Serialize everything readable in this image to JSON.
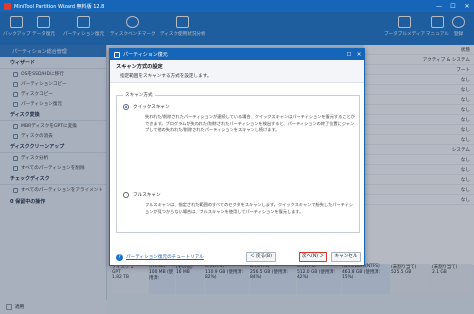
{
  "app": {
    "title": "MiniTool Partition Wizard 無料版 12.8"
  },
  "toolbar": {
    "items": [
      "バックアップ",
      "データ復元",
      "パーティション復元",
      "ディスクベンチマーク",
      "ディスク使用状況分析"
    ],
    "right_items": [
      "ブータブルメディア",
      "マニュアル",
      "登録"
    ]
  },
  "sidebar": {
    "tab": "パーティション総合管理",
    "groups": [
      {
        "title": "ウィザード",
        "items": [
          "OSをSSD/HDに移行",
          "パーティションコピー",
          "ディスクコピー",
          "パーティション復元"
        ]
      },
      {
        "title": "ディスク変換",
        "items": [
          "MBRディスクをGPTに変換",
          "ディスクの消去"
        ]
      },
      {
        "title": "ディスククリーンアップ",
        "items": [
          "ディスク分析",
          "すべてのパーティションを削除"
        ]
      },
      {
        "title": "チェックディスク",
        "items": [
          "すべてのパーティションをアライメント"
        ]
      }
    ],
    "pending": "0 保留中の操作",
    "apply": "適用"
  },
  "right_column": {
    "rows": [
      "状態",
      "アクティブ & システム",
      "ブート",
      "なし",
      "なし",
      "なし",
      "なし",
      "なし",
      "なし",
      "なし",
      "システム",
      "なし",
      "なし",
      "なし",
      "なし",
      "なし"
    ]
  },
  "diskmap": [
    {
      "name": "ディスク 1",
      "type": "GPT",
      "size": "1.82 TB"
    },
    {
      "name": "(FAT32)",
      "size": "100 MB (使用済:"
    },
    {
      "name": "(その他)",
      "size": "16 MB"
    },
    {
      "name": "C:(NTFS)",
      "size": "110.9 GB (使用済: 82%)"
    },
    {
      "name": "D:(NTFS)",
      "size": "256.5 GB (使用済: 84%)"
    },
    {
      "name": "E:(NTFS)",
      "size": "512.0 GB (使用済: 42%)"
    },
    {
      "name": "homeware(NTFS)",
      "size": "463.8 GB (使用済: 15%)"
    },
    {
      "name": "(未割り当て)",
      "size": "525.5 GB"
    },
    {
      "name": "(未割り当て)",
      "size": "2.1 GB"
    }
  ],
  "dialog": {
    "title": "パーティション復元",
    "heading": "スキャン方式の設定",
    "subheading": "指定範囲をスキャンする方式を設定します。",
    "group_label": "スキャン方式",
    "options": [
      {
        "label": "クイックスキャン",
        "selected": true,
        "desc": "失われた/削除されたパーティションが連続している場合、クイックスキャンはパーティションを復元することができます。プログラムが失われた/削除されたパーティションを検出すると、パーティションの終了位置にジャンプして他の失われた/削除されたパーティションをスキャンし続けます。"
      },
      {
        "label": "フルスキャン",
        "selected": false,
        "desc": "フルスキャンは、指定された範囲のすべてのセクタをスキャンします。クイックスキャンで紛失したパーティションが見つからない場合は、フルスキャンを使用してパーティションを復元します。"
      }
    ],
    "help_link": "パーティション復元のチュートリアル",
    "back": "＜ 戻る(B)",
    "next": "次へ(N) ＞",
    "cancel": "キャンセル"
  }
}
